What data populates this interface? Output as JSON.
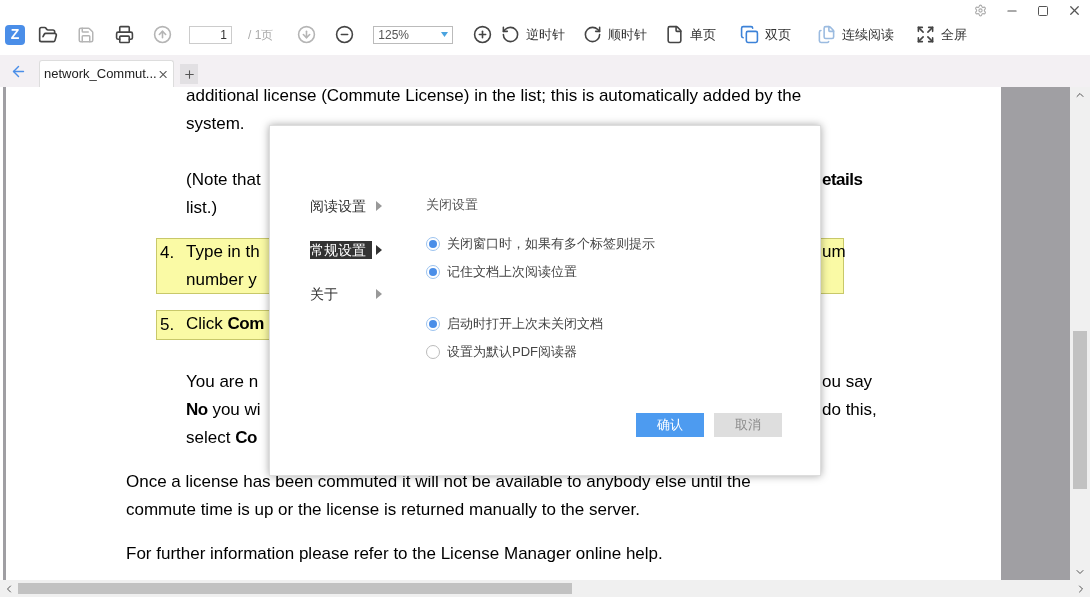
{
  "toolbar": {
    "logo": "Z",
    "save": {
      "disabled": true
    },
    "prev_page": {
      "disabled": true
    },
    "page_input": {
      "value": "1"
    },
    "page_total": "/ 1页",
    "next_page": {
      "disabled": true
    },
    "zoom": {
      "value": "125%"
    },
    "rotate_left": "逆时针",
    "rotate_right": "顺时针",
    "single_page": "单页",
    "double_page": "双页",
    "continuous": "连续阅读",
    "fullscreen": "全屏"
  },
  "tabs": [
    {
      "label": "network_Commut...",
      "selected": true
    }
  ],
  "document": {
    "blocks": [
      {
        "kind": "text",
        "lines": [
          {
            "left": "additional license (Commute License) in the list; this is automatically added by the"
          },
          {
            "left": "system."
          }
        ]
      },
      {
        "kind": "text",
        "lines": [
          {
            "left": "(Note that",
            "right": "**etails**"
          },
          {
            "left": "list.)"
          }
        ]
      },
      {
        "kind": "item",
        "number": "4.",
        "lines": [
          {
            "left": "Type in th",
            "right": "um"
          },
          {
            "left": "number y"
          }
        ]
      },
      {
        "kind": "item",
        "number": "5.",
        "lines": [
          {
            "left": "Click **Com**"
          }
        ]
      },
      {
        "kind": "text",
        "lines": [
          {
            "left": "You are n",
            "right": "ou say"
          },
          {
            "left": "**No** you wi",
            "right": "do this,"
          },
          {
            "left": "select **Co**"
          }
        ]
      },
      {
        "kind": "body",
        "lines": [
          {
            "left": "Once a license has been commuted it will not be available to anybody else until the"
          },
          {
            "left": "commute time is up or the license is returned manually to the server."
          }
        ]
      },
      {
        "kind": "body",
        "lines": [
          {
            "left": "For further information please refer to the License Manager online help."
          }
        ]
      }
    ]
  },
  "dialog": {
    "nav": [
      {
        "label": "阅读设置",
        "selected": false
      },
      {
        "label": "常规设置",
        "selected": true
      },
      {
        "label": "关于",
        "selected": false
      }
    ],
    "heading": "关闭设置",
    "options": [
      {
        "label": "关闭窗口时，如果有多个标签则提示",
        "checked": true
      },
      {
        "label": "记住文档上次阅读位置",
        "checked": true
      },
      {
        "label": "启动时打开上次未关闭文档",
        "checked": true
      },
      {
        "label": "设置为默认PDF阅读器",
        "checked": false
      }
    ],
    "buttons": [
      {
        "label": "确认",
        "disabled": false
      },
      {
        "label": "取消",
        "disabled": true
      }
    ]
  }
}
